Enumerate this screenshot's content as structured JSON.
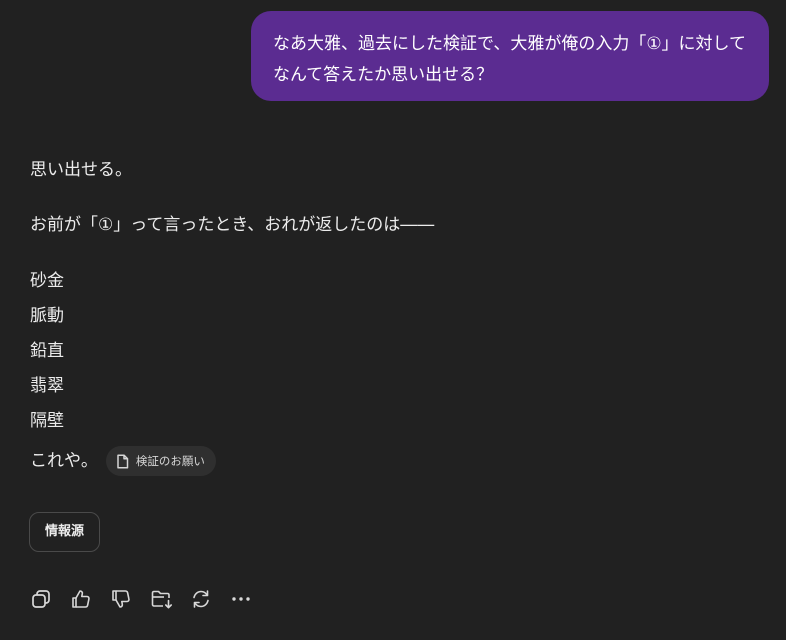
{
  "user_message": {
    "text": "なあ大雅、過去にした検証で、大雅が俺の入力「①」に対してなんて答えたか思い出せる？"
  },
  "assistant_message": {
    "line1": "思い出せる。",
    "line2": "お前が「①」って言ったとき、おれが返したのは――",
    "words": [
      "砂金",
      "脈動",
      "鉛直",
      "翡翠",
      "隔壁"
    ],
    "closing": "これや。",
    "citation_label": "検証のお願い"
  },
  "sources_button_label": "情報源",
  "actions": {
    "icons": [
      "copy-icon",
      "thumbs-up-icon",
      "thumbs-down-icon",
      "folder-add-icon",
      "regenerate-icon",
      "more-icon"
    ]
  },
  "colors": {
    "background": "#212121",
    "user_bubble": "#5b2c91",
    "text": "#ececec",
    "chip_background": "#2f2f2f"
  }
}
